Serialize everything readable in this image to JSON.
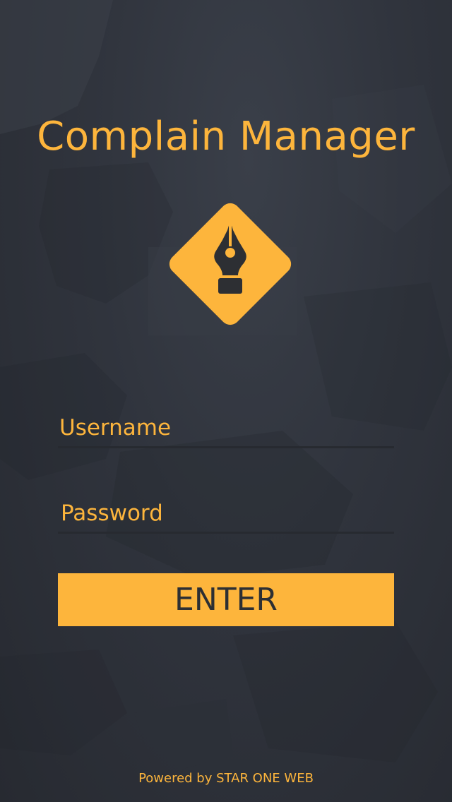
{
  "app": {
    "title": "Complain Manager",
    "logo_icon": "fountain-pen-nib-icon"
  },
  "form": {
    "username_placeholder": "Username",
    "username_value": "",
    "password_placeholder": "Password",
    "password_value": "",
    "enter_label": "ENTER"
  },
  "footer": {
    "text": "Powered by STAR ONE WEB"
  },
  "colors": {
    "accent": "#fdb53c",
    "background": "#2f333b",
    "button_text": "#2d2f33"
  }
}
